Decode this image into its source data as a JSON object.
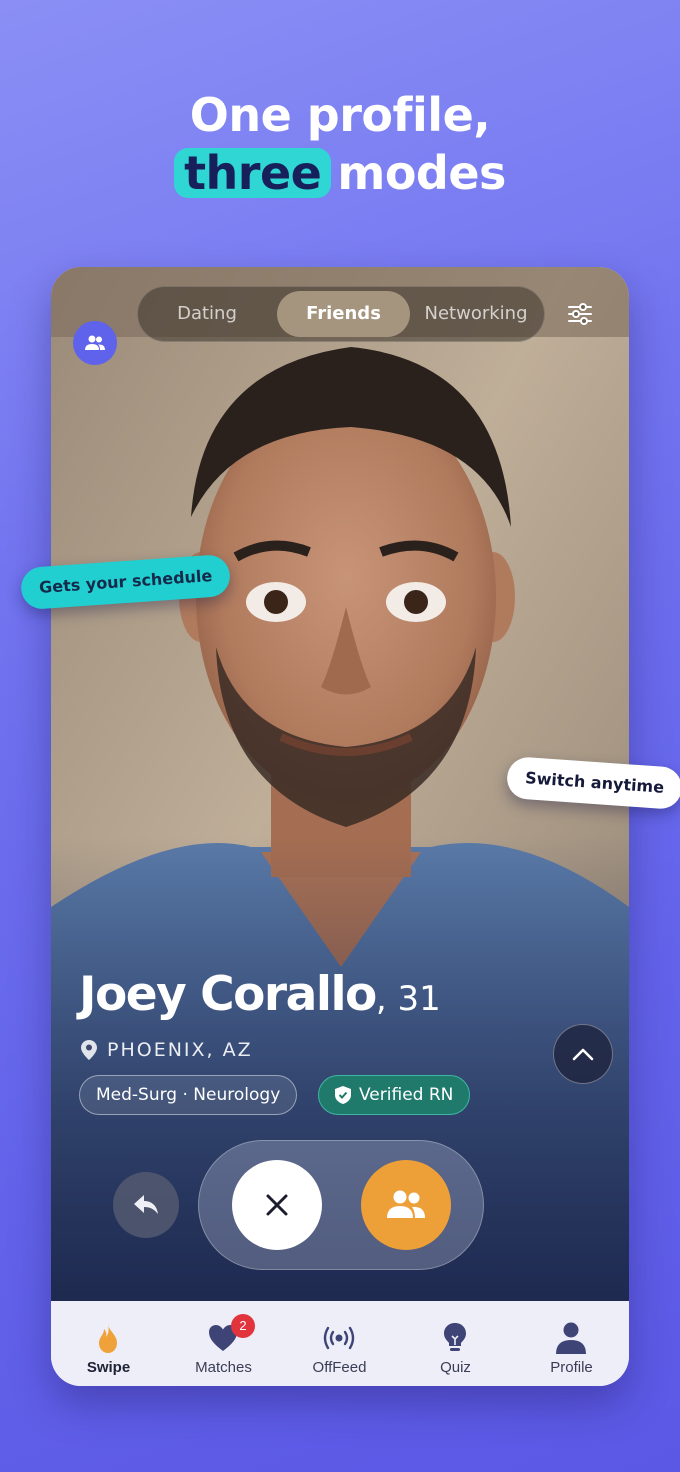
{
  "headline": {
    "line1": "One profile,",
    "highlight": "three",
    "line2_rest": "modes"
  },
  "mode_switcher": {
    "options": [
      "Dating",
      "Friends",
      "Networking"
    ],
    "selected": "Friends"
  },
  "profile": {
    "name": "Joey Corallo",
    "age_suffix": ", 31",
    "location": "PHOENIX, AZ",
    "specialty_chip": "Med-Surg · Neurology",
    "verified_chip": "Verified RN"
  },
  "stickers": {
    "schedule": "Gets your schedule",
    "switch": "Switch anytime"
  },
  "tabs": [
    {
      "label": "Swipe",
      "icon": "flame-icon",
      "active": true
    },
    {
      "label": "Matches",
      "icon": "heart-icon",
      "badge": "2"
    },
    {
      "label": "OffFeed",
      "icon": "broadcast-icon"
    },
    {
      "label": "Quiz",
      "icon": "lightbulb-icon"
    },
    {
      "label": "Profile",
      "icon": "person-icon"
    }
  ],
  "colors": {
    "background": "#6b6cec",
    "accent_teal": "#2fd6d4",
    "like_orange": "#eea038",
    "verified_green": "#207a6c",
    "badge_red": "#e1343d"
  }
}
